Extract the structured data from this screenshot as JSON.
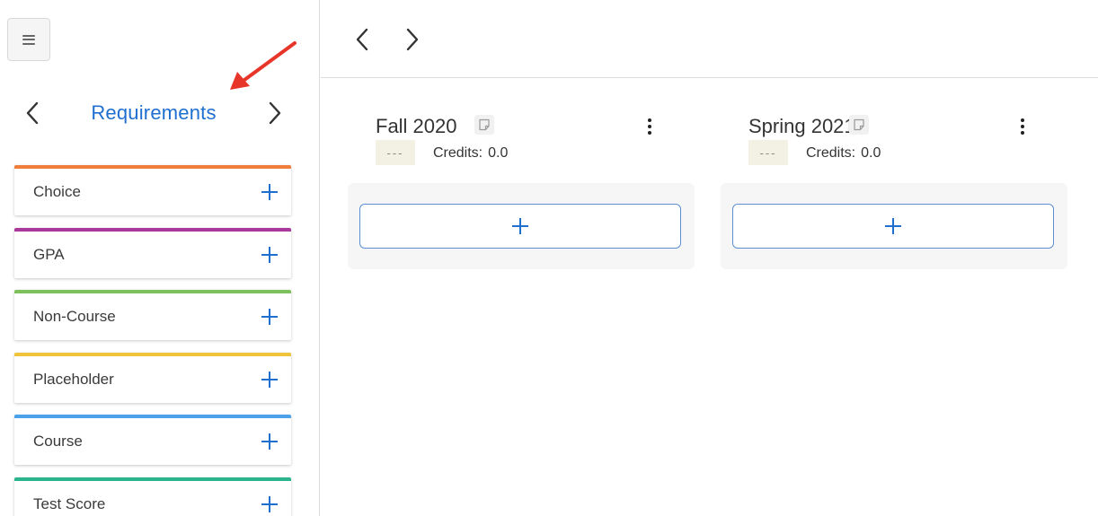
{
  "sidebar": {
    "menu_icon": "hamburger-menu-icon",
    "panel_title": "Requirements",
    "prev_icon": "chevron-left-icon",
    "next_icon": "chevron-right-icon",
    "annotation_color": "#e8352a",
    "items": [
      {
        "label": "Choice",
        "color": "#f07d3a"
      },
      {
        "label": "GPA",
        "color": "#a9399a"
      },
      {
        "label": "Non-Course",
        "color": "#7dc15c"
      },
      {
        "label": "Placeholder",
        "color": "#f0c43a"
      },
      {
        "label": "Course",
        "color": "#4aa3ea"
      },
      {
        "label": "Test Score",
        "color": "#2bb58f"
      }
    ]
  },
  "main": {
    "nav": {
      "prev_icon": "chevron-left-icon",
      "next_icon": "chevron-right-icon"
    },
    "terms": [
      {
        "name": "Fall 2020",
        "status": "---",
        "credits_label": "Credits:",
        "credits_value": "0.0"
      },
      {
        "name": "Spring 2021",
        "status": "---",
        "credits_label": "Credits:",
        "credits_value": "0.0"
      }
    ]
  },
  "colors": {
    "accent": "#1f6fd0",
    "button_border": "#5b8fd1",
    "badge_bg": "#f3f0e4"
  }
}
